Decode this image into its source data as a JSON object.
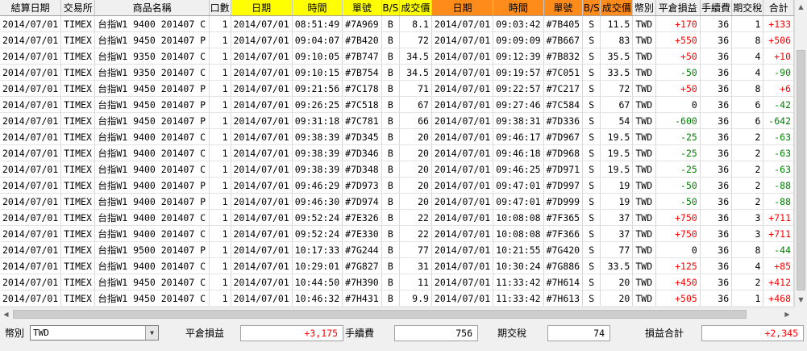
{
  "grid": {
    "columns": [
      "結算日期",
      "交易所",
      "商品名稱",
      "口數",
      "日期",
      "時間",
      "單號",
      "B/S",
      "成交價",
      "日期",
      "時間",
      "單號",
      "B/S",
      "成交價",
      "幣別",
      "平倉損益",
      "手續費",
      "期交稅",
      "合計"
    ],
    "rows": [
      [
        "2014/07/01",
        "TIMEX",
        "台指W1 9400 201407 C",
        "1",
        "2014/07/01",
        "08:51:49",
        "#7A969",
        "B",
        "8.1",
        "2014/07/01",
        "09:03:42",
        "#7B405",
        "S",
        "11.5",
        "TWD",
        "+170",
        "36",
        "1",
        "+133"
      ],
      [
        "2014/07/01",
        "TIMEX",
        "台指W1 9450 201407 P",
        "1",
        "2014/07/01",
        "09:04:07",
        "#7B420",
        "B",
        "72",
        "2014/07/01",
        "09:09:09",
        "#7B667",
        "S",
        "83",
        "TWD",
        "+550",
        "36",
        "8",
        "+506"
      ],
      [
        "2014/07/01",
        "TIMEX",
        "台指W1 9350 201407 C",
        "1",
        "2014/07/01",
        "09:10:05",
        "#7B747",
        "B",
        "34.5",
        "2014/07/01",
        "09:12:39",
        "#7B832",
        "S",
        "35.5",
        "TWD",
        "+50",
        "36",
        "4",
        "+10"
      ],
      [
        "2014/07/01",
        "TIMEX",
        "台指W1 9350 201407 C",
        "1",
        "2014/07/01",
        "09:10:15",
        "#7B754",
        "B",
        "34.5",
        "2014/07/01",
        "09:19:57",
        "#7C051",
        "S",
        "33.5",
        "TWD",
        "-50",
        "36",
        "4",
        "-90"
      ],
      [
        "2014/07/01",
        "TIMEX",
        "台指W1 9450 201407 P",
        "1",
        "2014/07/01",
        "09:21:56",
        "#7C178",
        "B",
        "71",
        "2014/07/01",
        "09:22:57",
        "#7C217",
        "S",
        "72",
        "TWD",
        "+50",
        "36",
        "8",
        "+6"
      ],
      [
        "2014/07/01",
        "TIMEX",
        "台指W1 9450 201407 P",
        "1",
        "2014/07/01",
        "09:26:25",
        "#7C518",
        "B",
        "67",
        "2014/07/01",
        "09:27:46",
        "#7C584",
        "S",
        "67",
        "TWD",
        "0",
        "36",
        "6",
        "-42"
      ],
      [
        "2014/07/01",
        "TIMEX",
        "台指W1 9450 201407 P",
        "1",
        "2014/07/01",
        "09:31:18",
        "#7C781",
        "B",
        "66",
        "2014/07/01",
        "09:38:31",
        "#7D336",
        "S",
        "54",
        "TWD",
        "-600",
        "36",
        "6",
        "-642"
      ],
      [
        "2014/07/01",
        "TIMEX",
        "台指W1 9400 201407 C",
        "1",
        "2014/07/01",
        "09:38:39",
        "#7D345",
        "B",
        "20",
        "2014/07/01",
        "09:46:17",
        "#7D967",
        "S",
        "19.5",
        "TWD",
        "-25",
        "36",
        "2",
        "-63"
      ],
      [
        "2014/07/01",
        "TIMEX",
        "台指W1 9400 201407 C",
        "1",
        "2014/07/01",
        "09:38:39",
        "#7D346",
        "B",
        "20",
        "2014/07/01",
        "09:46:18",
        "#7D968",
        "S",
        "19.5",
        "TWD",
        "-25",
        "36",
        "2",
        "-63"
      ],
      [
        "2014/07/01",
        "TIMEX",
        "台指W1 9400 201407 C",
        "1",
        "2014/07/01",
        "09:38:39",
        "#7D348",
        "B",
        "20",
        "2014/07/01",
        "09:46:25",
        "#7D971",
        "S",
        "19.5",
        "TWD",
        "-25",
        "36",
        "2",
        "-63"
      ],
      [
        "2014/07/01",
        "TIMEX",
        "台指W1 9400 201407 P",
        "1",
        "2014/07/01",
        "09:46:29",
        "#7D973",
        "B",
        "20",
        "2014/07/01",
        "09:47:01",
        "#7D997",
        "S",
        "19",
        "TWD",
        "-50",
        "36",
        "2",
        "-88"
      ],
      [
        "2014/07/01",
        "TIMEX",
        "台指W1 9400 201407 P",
        "1",
        "2014/07/01",
        "09:46:30",
        "#7D974",
        "B",
        "20",
        "2014/07/01",
        "09:47:01",
        "#7D999",
        "S",
        "19",
        "TWD",
        "-50",
        "36",
        "2",
        "-88"
      ],
      [
        "2014/07/01",
        "TIMEX",
        "台指W1 9400 201407 C",
        "1",
        "2014/07/01",
        "09:52:24",
        "#7E326",
        "B",
        "22",
        "2014/07/01",
        "10:08:08",
        "#7F365",
        "S",
        "37",
        "TWD",
        "+750",
        "36",
        "3",
        "+711"
      ],
      [
        "2014/07/01",
        "TIMEX",
        "台指W1 9400 201407 C",
        "1",
        "2014/07/01",
        "09:52:24",
        "#7E330",
        "B",
        "22",
        "2014/07/01",
        "10:08:08",
        "#7F366",
        "S",
        "37",
        "TWD",
        "+750",
        "36",
        "3",
        "+711"
      ],
      [
        "2014/07/01",
        "TIMEX",
        "台指W1 9500 201407 P",
        "1",
        "2014/07/01",
        "10:17:33",
        "#7G244",
        "B",
        "77",
        "2014/07/01",
        "10:21:55",
        "#7G420",
        "S",
        "77",
        "TWD",
        "0",
        "36",
        "8",
        "-44"
      ],
      [
        "2014/07/01",
        "TIMEX",
        "台指W1 9400 201407 C",
        "1",
        "2014/07/01",
        "10:29:01",
        "#7G827",
        "B",
        "31",
        "2014/07/01",
        "10:30:24",
        "#7G886",
        "S",
        "33.5",
        "TWD",
        "+125",
        "36",
        "4",
        "+85"
      ],
      [
        "2014/07/01",
        "TIMEX",
        "台指W1 9450 201407 C",
        "1",
        "2014/07/01",
        "10:44:50",
        "#7H390",
        "B",
        "11",
        "2014/07/01",
        "11:33:42",
        "#7H614",
        "S",
        "20",
        "TWD",
        "+450",
        "36",
        "2",
        "+412"
      ],
      [
        "2014/07/01",
        "TIMEX",
        "台指W1 9450 201407 C",
        "1",
        "2014/07/01",
        "10:46:32",
        "#7H431",
        "B",
        "9.9",
        "2014/07/01",
        "11:33:42",
        "#7H613",
        "S",
        "20",
        "TWD",
        "+505",
        "36",
        "1",
        "+468"
      ]
    ]
  },
  "summary": {
    "currency_label": "幣別",
    "currency_value": "TWD",
    "pnl_label": "平倉損益",
    "pnl_value": "+3,175",
    "fee_label": "手續費",
    "fee_value": "756",
    "tax_label": "期交稅",
    "tax_value": "74",
    "total_label": "損益合計",
    "total_value": "+2,345"
  },
  "colors": {
    "entry_header": "#ffff00",
    "exit_header": "#ff8c1a",
    "positive": "#ff0000",
    "negative": "#008000"
  },
  "icons": {
    "scroll_up": "▲",
    "scroll_down": "▼",
    "scroll_left": "◀",
    "scroll_right": "▶",
    "dropdown": "▼"
  }
}
